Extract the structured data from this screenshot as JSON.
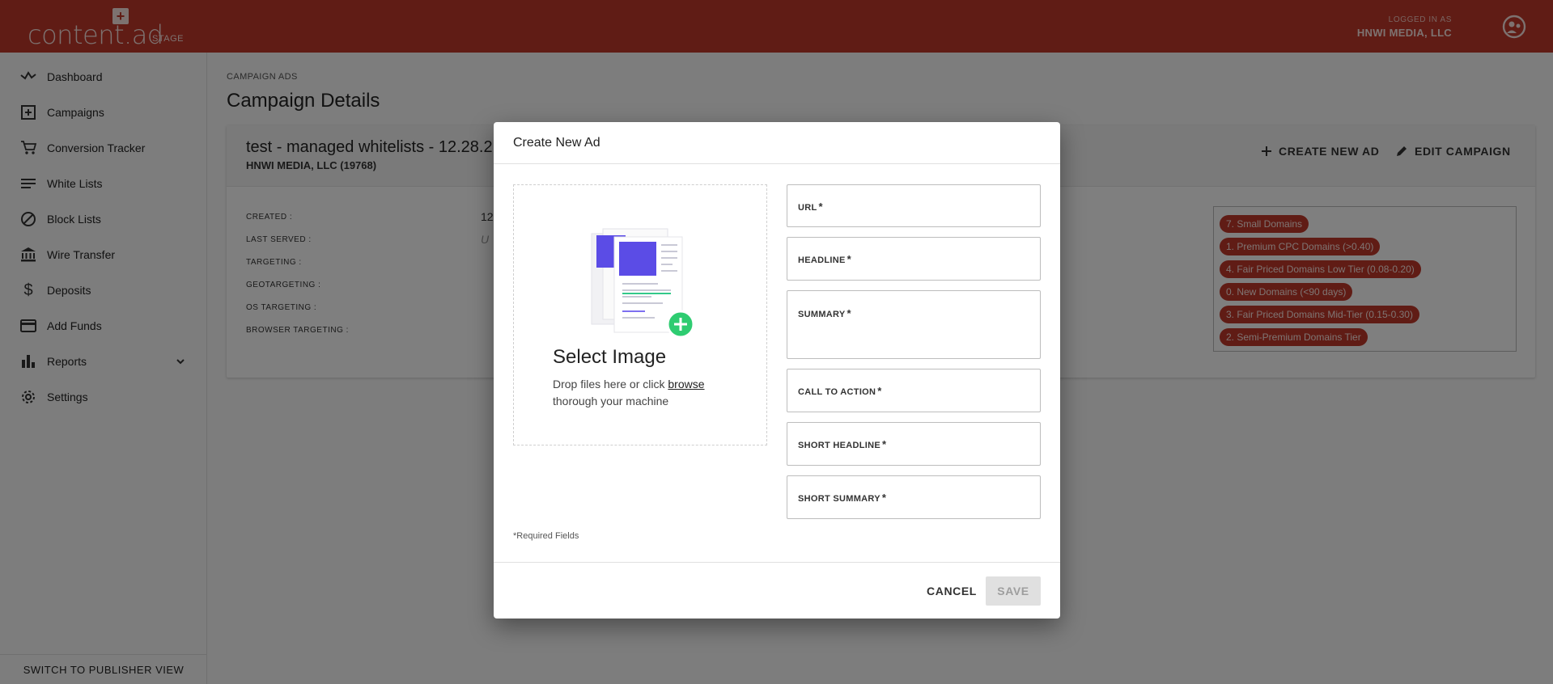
{
  "header": {
    "logo_text": "content.ad",
    "logo_plus": "+",
    "env_label": "STAGE",
    "logged_in_label": "LOGGED IN AS",
    "user_name": "HNWI MEDIA, LLC",
    "brand_color": "#c0392b"
  },
  "sidebar": {
    "items": [
      {
        "label": "Dashboard",
        "icon": "trend-icon"
      },
      {
        "label": "Campaigns",
        "icon": "add-box-icon"
      },
      {
        "label": "Conversion Tracker",
        "icon": "cart-icon"
      },
      {
        "label": "White Lists",
        "icon": "list-icon"
      },
      {
        "label": "Block Lists",
        "icon": "block-icon"
      },
      {
        "label": "Wire Transfer",
        "icon": "bank-icon"
      },
      {
        "label": "Deposits",
        "icon": "dollar-icon"
      },
      {
        "label": "Add Funds",
        "icon": "card-icon"
      },
      {
        "label": "Reports",
        "icon": "bar-chart-icon"
      },
      {
        "label": "Settings",
        "icon": "gear-icon"
      }
    ],
    "switch_label": "SWITCH TO PUBLISHER VIEW"
  },
  "main": {
    "breadcrumb": "CAMPAIGN ADS",
    "title": "Campaign Details",
    "campaign": {
      "name": "test - managed whitelists - 12.28.2",
      "advertiser": "HNWI MEDIA, LLC (19768)",
      "create_btn": "CREATE NEW AD",
      "edit_btn": "EDIT CAMPAIGN",
      "details": [
        {
          "label": "CREATED :",
          "value": "12"
        },
        {
          "label": "LAST SERVED :",
          "value": "U"
        },
        {
          "label": "TARGETING :",
          "value": ""
        },
        {
          "label": "GEOTARGETING :",
          "value": ""
        },
        {
          "label": "OS TARGETING :",
          "value": ""
        },
        {
          "label": "BROWSER TARGETING :",
          "value": ""
        }
      ],
      "tags": [
        "7. Small Domains",
        "1. Premium CPC Domains (>0.40)",
        "4. Fair Priced Domains Low Tier (0.08-0.20)",
        "0. New Domains (<90 days)",
        "3. Fair Priced Domains Mid-Tier (0.15-0.30)",
        "2. Semi-Premium Domains Tier"
      ]
    }
  },
  "modal": {
    "title": "Create New Ad",
    "dropzone": {
      "title": "Select Image",
      "text_before": "Drop files here or click ",
      "link": "browse",
      "text_after": "thorough your machine"
    },
    "fields": [
      {
        "label": "URL",
        "required": "*"
      },
      {
        "label": "HEADLINE",
        "required": "*"
      },
      {
        "label": "SUMMARY",
        "required": "*"
      },
      {
        "label": "CALL TO ACTION",
        "required": "*"
      },
      {
        "label": "SHORT HEADLINE",
        "required": "*"
      },
      {
        "label": "SHORT SUMMARY",
        "required": "*"
      }
    ],
    "required_note": "*Required Fields",
    "cancel": "CANCEL",
    "save": "SAVE"
  }
}
